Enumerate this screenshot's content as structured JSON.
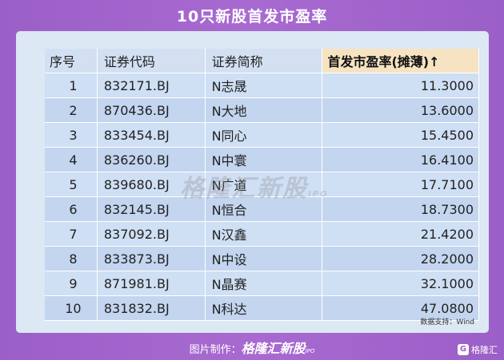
{
  "title": "10只新股首发市盈率",
  "table": {
    "headers": {
      "rank": "序号",
      "code": "证券代码",
      "name": "证券简称",
      "pe": "首发市盈率(摊薄)↑"
    },
    "rows": [
      {
        "rank": "1",
        "code": "832171.BJ",
        "name": "N志晟",
        "pe": "11.3000"
      },
      {
        "rank": "2",
        "code": "870436.BJ",
        "name": "N大地",
        "pe": "13.6000"
      },
      {
        "rank": "3",
        "code": "833454.BJ",
        "name": "N同心",
        "pe": "15.4500"
      },
      {
        "rank": "4",
        "code": "836260.BJ",
        "name": "N中寰",
        "pe": "16.4100"
      },
      {
        "rank": "5",
        "code": "839680.BJ",
        "name": "N广道",
        "pe": "17.7100"
      },
      {
        "rank": "6",
        "code": "832145.BJ",
        "name": "N恒合",
        "pe": "18.7300"
      },
      {
        "rank": "7",
        "code": "837092.BJ",
        "name": "N汉鑫",
        "pe": "21.4200"
      },
      {
        "rank": "8",
        "code": "833873.BJ",
        "name": "N中设",
        "pe": "28.2000"
      },
      {
        "rank": "9",
        "code": "871981.BJ",
        "name": "N晶赛",
        "pe": "32.1000"
      },
      {
        "rank": "10",
        "code": "831832.BJ",
        "name": "N科达",
        "pe": "47.0800"
      }
    ]
  },
  "watermark": {
    "text": "格隆汇新股",
    "suffix": "IPO"
  },
  "source": "数据支持：Wind",
  "footer": {
    "prefix": "图片制作：",
    "brand": "格隆汇新股",
    "suffix": "IPO"
  },
  "corner": {
    "logo": "G",
    "text": "格隆汇"
  }
}
